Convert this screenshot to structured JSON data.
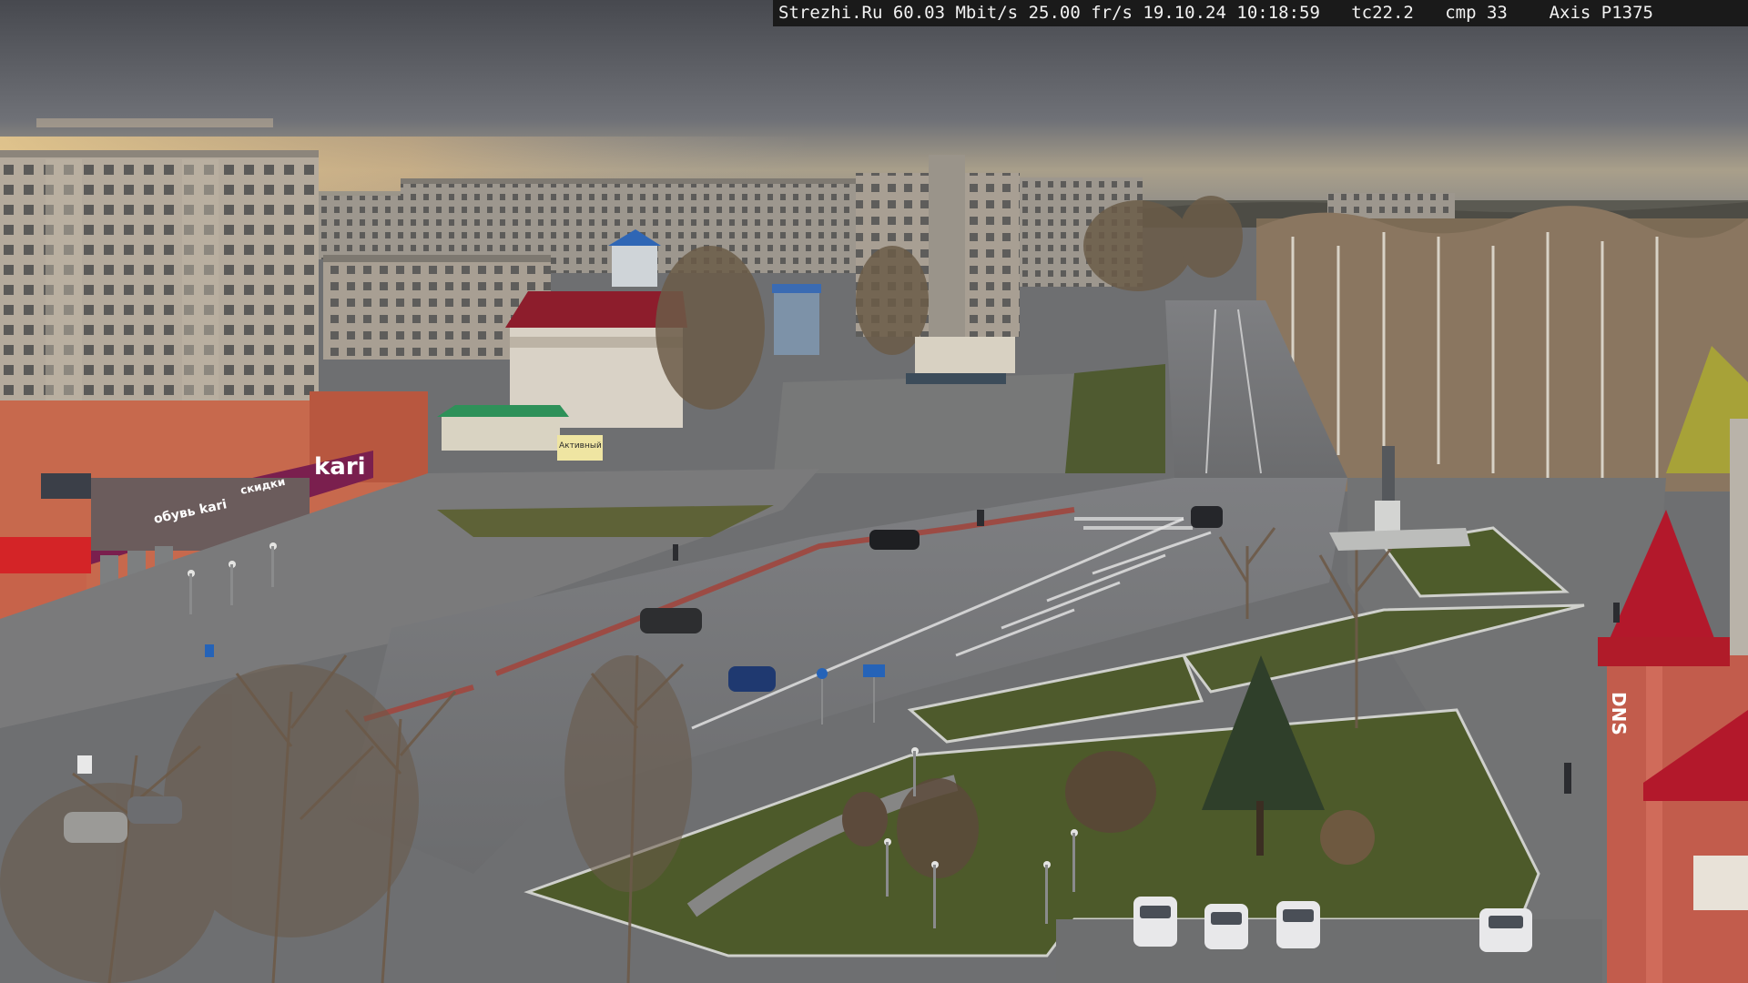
{
  "overlay": {
    "site": "Strezhi.Ru",
    "bitrate": "60.03 Mbit/s",
    "framerate": "25.00 fr/s",
    "date": "19.10.24",
    "time": "10:18:59",
    "tc": "tc22.2",
    "cmp": "cmp 33",
    "camera": "Axis P1375"
  },
  "signs": {
    "store_kari": "kari",
    "store_kari_sub": "обувь kari",
    "store_kari_sub2": "скидки",
    "shop_aktivnye": "Активный",
    "tower_letters": "DNS"
  },
  "colors": {
    "sky_top": "#4a4d55",
    "sky_horizon": "#c9b48c",
    "road": "#7b7c7e",
    "grass": "#4c5a2c",
    "kari_sign": "#7a1f4e",
    "tower_roof": "#b3182b"
  }
}
